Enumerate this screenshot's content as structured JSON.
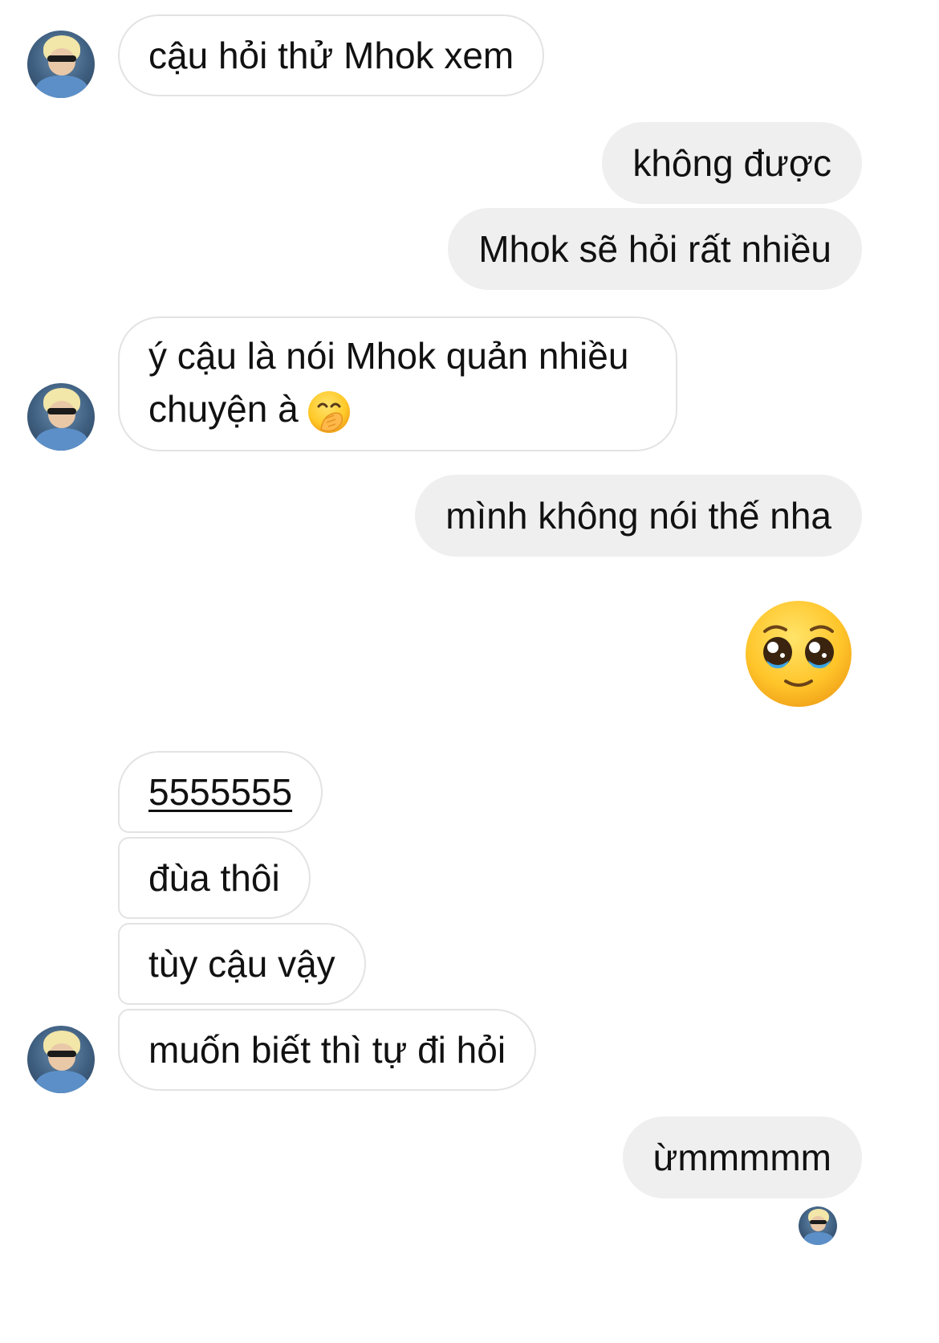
{
  "messages": [
    {
      "text": "cậu hỏi thử Mhok xem"
    },
    {
      "text": "không được"
    },
    {
      "text": "Mhok sẽ hỏi rất nhiều"
    },
    {
      "text": "ý cậu là nói Mhok quản nhiều chuyện à"
    },
    {
      "text": "mình không nói thế nha"
    },
    {
      "text": "5555555"
    },
    {
      "text": "đùa thôi"
    },
    {
      "text": "tùy cậu vậy"
    },
    {
      "text": "muốn biết thì tự đi hỏi"
    },
    {
      "text": "ừmmmmm"
    }
  ],
  "icons": {
    "hand_over_mouth": "face-with-hand-over-mouth-icon",
    "pleading_face": "pleading-face-icon"
  },
  "colors": {
    "outgoing_bubble": "#efefef",
    "incoming_border": "#e3e3e3",
    "text": "#111111"
  }
}
